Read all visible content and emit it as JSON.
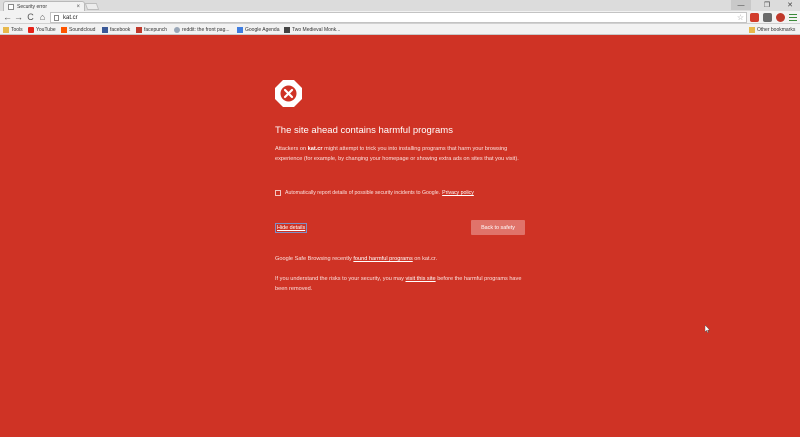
{
  "tab": {
    "title": "Security error",
    "close": "×"
  },
  "window_controls": {
    "minimize": "—",
    "maximize": "❐",
    "close": "✕"
  },
  "toolbar": {
    "back": "←",
    "forward": "→",
    "reload": "C",
    "home": "⌂",
    "url": "kat.cr",
    "star": "☆",
    "extensions": [
      "ext-red-icon",
      "ext-gray-icon",
      "ext-badge-icon"
    ]
  },
  "bookmarks": {
    "items": [
      {
        "label": "Tools",
        "color": "#e8b84b"
      },
      {
        "label": "YouTube",
        "color": "#e62117"
      },
      {
        "label": "Soundcloud",
        "color": "#ff5500"
      },
      {
        "label": "facebook",
        "color": "#3b5998"
      },
      {
        "label": "facepunch",
        "color": "#c0392b"
      },
      {
        "label": "reddit: the front pag...",
        "color": "#9aa7b8"
      },
      {
        "label": "Google Agenda",
        "color": "#3f7de0"
      },
      {
        "label": "Two Medieval Monk...",
        "color": "#444444"
      }
    ],
    "other": {
      "label": "Other bookmarks",
      "color": "#e8b84b"
    }
  },
  "interstitial": {
    "background_color": "#cf3325",
    "heading": "The site ahead contains harmful programs",
    "desc_before": "Attackers on ",
    "desc_domain": "kat.cr",
    "desc_after": " might attempt to trick you into installing programs that harm your browsing experience (for example, by changing your homepage or showing extra ads on sites that you visit).",
    "report_label": "Automatically report details of possible security incidents to Google.",
    "privacy_link": "Privacy policy",
    "hide_details": "Hide details",
    "back_button": "Back to safety",
    "gsb_before": "Google Safe Browsing recently ",
    "gsb_link": "found harmful programs",
    "gsb_after": " on kat.cr.",
    "risk_before": "If you understand the risks to your security, you may ",
    "risk_link": "visit this site",
    "risk_after": " before the harmful programs have been removed."
  }
}
